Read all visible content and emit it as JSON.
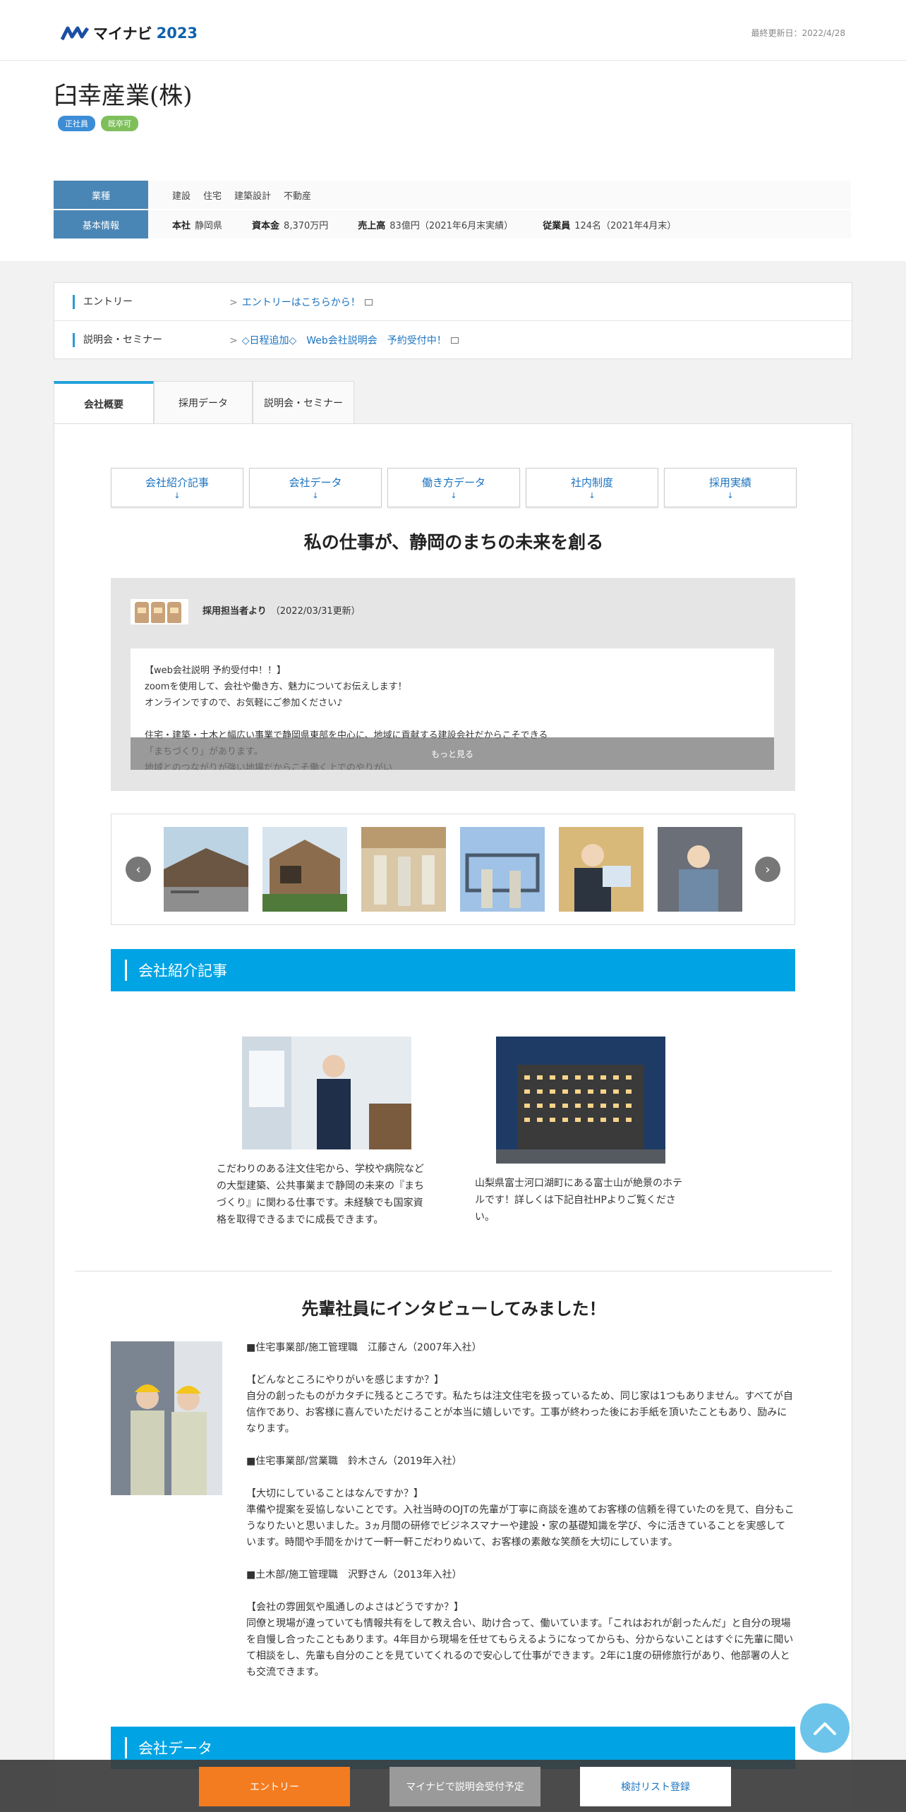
{
  "header": {
    "logo_text": "マイナビ",
    "logo_year": "2023",
    "updated": "最終更新日：2022/4/28"
  },
  "company": {
    "name": "臼幸産業(株)",
    "badges": [
      "正社員",
      "既卒可"
    ]
  },
  "info": {
    "industry_label": "業種",
    "industries": [
      "建設",
      "住宅",
      "建築設計",
      "不動産"
    ],
    "basic_label": "基本情報",
    "hq_key": "本社",
    "hq_val": "静岡県",
    "capital_key": "資本金",
    "capital_val": "8,370万円",
    "sales_key": "売上高",
    "sales_val": "83億円（2021年6月末実績）",
    "employees_key": "従業員",
    "employees_val": "124名（2021年4月末）"
  },
  "entry": {
    "rows": [
      {
        "label": "エントリー",
        "link": "エントリーはこちらから！"
      },
      {
        "label": "説明会・セミナー",
        "link": "◇日程追加◇　Web会社説明会　予約受付中！"
      }
    ]
  },
  "tabs": [
    "会社概要",
    "採用データ",
    "説明会・セミナー"
  ],
  "subnav": [
    "会社紹介記事",
    "会社データ",
    "働き方データ",
    "社内制度",
    "採用実績"
  ],
  "subnav_arrow": "↓",
  "catch": "私の仕事が、静岡のまちの未来を創る",
  "recruiter": {
    "from": "採用担当者より",
    "date": "（2022/03/31更新）",
    "text": "【web会社説明 予約受付中！！】\nzoomを使用して、会社や働き方、魅力についてお伝えします！\nオンラインですので、お気軽にご参加ください♪\n\n住宅・建築・土木と幅広い事業で静岡県東部を中心に、地域に貢献する建設会社だからこそできる\n「まちづくり」があります。\n地域とのつながりが強い地場だからこそ働く上でのやりがい",
    "more": "もっと見る"
  },
  "gallery_arrows": {
    "left": "‹",
    "right": "›"
  },
  "section_intro": "会社紹介記事",
  "articles": [
    {
      "caption": "こだわりのある注文住宅から、学校や病院などの大型建築、公共事業まで静岡の未来の『まちづくり』に関わる仕事です。未経験でも国家資格を取得できるまでに成長できます。"
    },
    {
      "caption": "山梨県富士河口湖町にある富士山が絶景のホテルです！詳しくは下記自社HPよりご覧ください。"
    }
  ],
  "interview": {
    "title": "先輩社員にインタビューしてみました！",
    "text": "■住宅事業部/施工管理職　江藤さん（2007年入社）\n\n【どんなところにやりがいを感じますか？】\n自分の創ったものがカタチに残るところです。私たちは注文住宅を扱っているため、同じ家は1つもありません。すべてが自信作であり、お客様に喜んでいただけることが本当に嬉しいです。工事が終わった後にお手紙を頂いたこともあり、励みになります。\n\n■住宅事業部/営業職　鈴木さん（2019年入社）\n\n【大切にしていることはなんですか？】\n準備や提案を妥協しないことです。入社当時のOJTの先輩が丁寧に商談を進めてお客様の信頼を得ていたのを見て、自分もこうなりたいと思いました。3ヵ月間の研修でビジネスマナーや建設・家の基礎知識を学び、今に活きていることを実感しています。時間や手間をかけて一軒一軒こだわりぬいて、お客様の素敵な笑顔を大切にしています。\n\n■土木部/施工管理職　沢野さん（2013年入社）\n\n【会社の雰囲気や風通しのよさはどうですか？】\n同僚と現場が違っていても情報共有をして教え合い、助け合って、働いています。「これはおれが創ったんだ」と自分の現場を自慢し合ったこともあります。4年目から現場を任せてもらえるようになってからも、分からないことはすぐに先輩に聞いて相談をし、先輩も自分のことを見ていてくれるので安心して仕事ができます。2年に1度の研修旅行があり、他部署の人とも交流できます。"
  },
  "section_data": "会社データ",
  "bottom_bar": {
    "entry": "エントリー",
    "seminar": "マイナビで説明会受付予定",
    "list": "検討リスト登録"
  }
}
